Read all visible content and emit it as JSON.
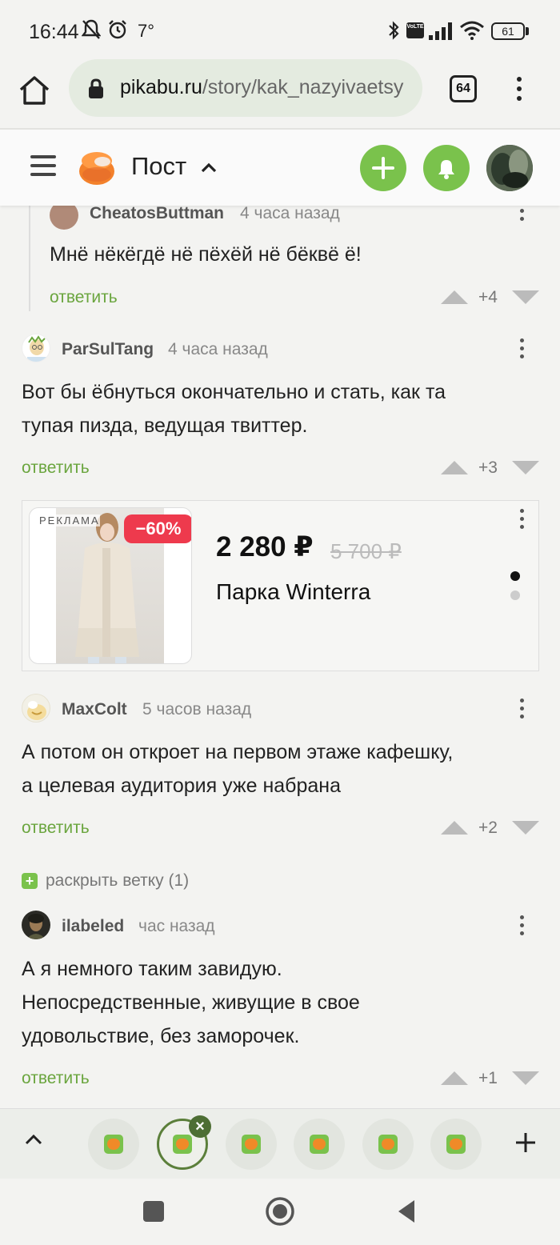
{
  "status_bar": {
    "time": "16:44",
    "temperature": "7°",
    "battery": "61",
    "network_badge": "VoLTE"
  },
  "browser": {
    "url_host": "pikabu.ru",
    "url_path": "/story/kak_nazyivaetsy",
    "tab_count": "64"
  },
  "header": {
    "title": "Пост"
  },
  "comments": [
    {
      "author": "CheatosButtman",
      "time": "4 часа назад",
      "text": "Мнё нёкёгдё нё пёхёй нё бёквё ё!",
      "reply": "ответить",
      "rating": "+4"
    },
    {
      "author": "ParSulTang",
      "time": "4 часа назад",
      "text_lines": [
        "Вот бы ёбнуться окончательно и стать, как та",
        "тупая пизда, ведущая твиттер."
      ],
      "reply": "ответить",
      "rating": "+3"
    },
    {
      "author": "MaxColt",
      "time": "5 часов назад",
      "text_lines": [
        "А потом он откроет на первом этаже кафешку,",
        "а целевая аудитория уже набрана"
      ],
      "reply": "ответить",
      "rating": "+2"
    },
    {
      "author": "ilabeled",
      "time": "час назад",
      "text_lines": [
        "А я немного таким завидую.",
        "Непосредственные, живущие в свое",
        "удовольствие, без заморочек."
      ],
      "reply": "ответить",
      "rating": "+1"
    }
  ],
  "ad": {
    "label": "РЕКЛАМА",
    "discount": "−60%",
    "price": "2 280 ₽",
    "old_price": "5 700 ₽",
    "name": "Парка Winterra"
  },
  "expand_branch": {
    "label": "раскрыть ветку (1)"
  },
  "colors": {
    "accent_green": "#7ac24c",
    "reply_green": "#6aa53e",
    "discount_red": "#ee3a4d"
  }
}
